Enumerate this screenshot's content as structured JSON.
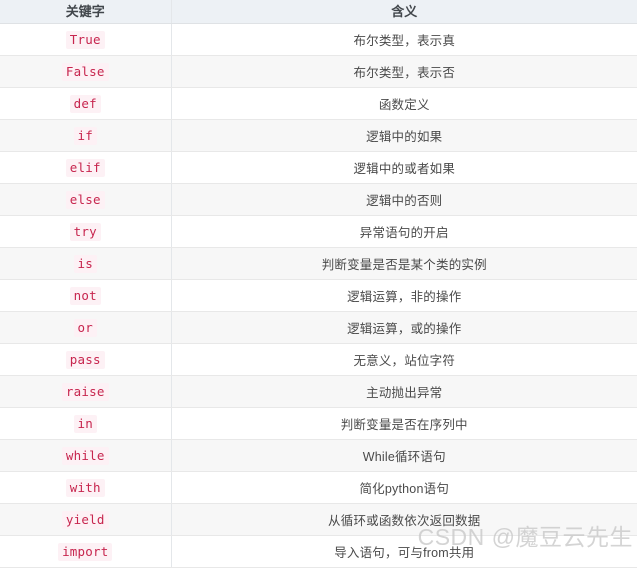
{
  "table": {
    "columns": [
      {
        "key": "keyword",
        "header": "关键字"
      },
      {
        "key": "meaning",
        "header": "含义"
      }
    ],
    "rows": [
      {
        "keyword": "True",
        "meaning": "布尔类型，表示真"
      },
      {
        "keyword": "False",
        "meaning": "布尔类型，表示否"
      },
      {
        "keyword": "def",
        "meaning": "函数定义"
      },
      {
        "keyword": "if",
        "meaning": "逻辑中的如果"
      },
      {
        "keyword": "elif",
        "meaning": "逻辑中的或者如果"
      },
      {
        "keyword": "else",
        "meaning": "逻辑中的否则"
      },
      {
        "keyword": "try",
        "meaning": "异常语句的开启"
      },
      {
        "keyword": "is",
        "meaning": "判断变量是否是某个类的实例"
      },
      {
        "keyword": "not",
        "meaning": "逻辑运算，非的操作"
      },
      {
        "keyword": "or",
        "meaning": "逻辑运算，或的操作"
      },
      {
        "keyword": "pass",
        "meaning": "无意义，站位字符"
      },
      {
        "keyword": "raise",
        "meaning": "主动抛出异常"
      },
      {
        "keyword": "in",
        "meaning": "判断变量是否在序列中"
      },
      {
        "keyword": "while",
        "meaning": "While循环语句"
      },
      {
        "keyword": "with",
        "meaning": "简化python语句"
      },
      {
        "keyword": "yield",
        "meaning": "从循环或函数依次返回数据"
      },
      {
        "keyword": "import",
        "meaning": "导入语句，可与from共用"
      }
    ]
  },
  "watermark": {
    "text": "CSDN @魔豆云先生"
  },
  "colors": {
    "header_bg": "#edf1f5",
    "header_text": "#41464b",
    "keyword_text": "#c7254e",
    "keyword_bg": "#fdf1f5",
    "meaning_text": "#4a4a4a",
    "row_even_bg": "#f7f7f7",
    "row_odd_bg": "#ffffff",
    "border": "#e8e8e8",
    "watermark_text": "#c8c8c8"
  }
}
